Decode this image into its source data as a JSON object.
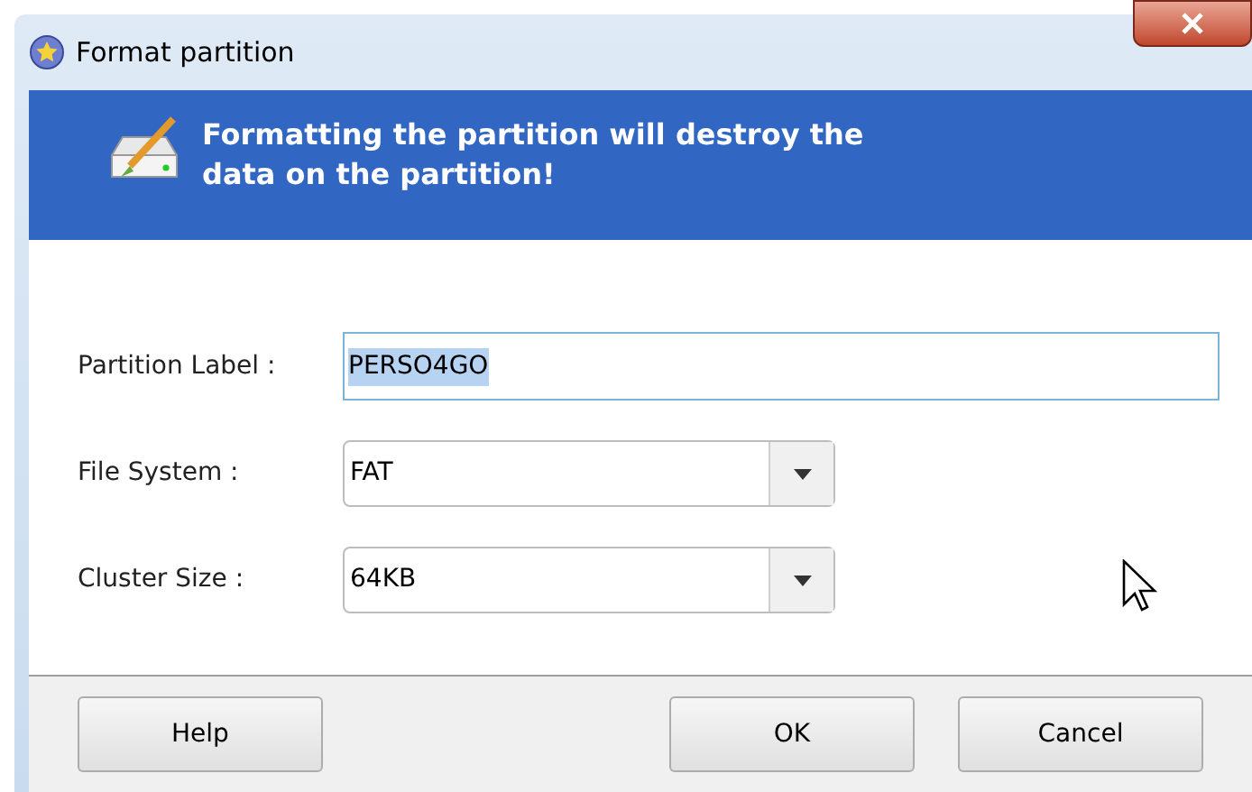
{
  "window": {
    "title": "Format partition"
  },
  "banner": {
    "message": "Formatting the partition will destroy the data on the partition!"
  },
  "fields": [
    {
      "kind": "text",
      "label": "Partition Label :",
      "value": "PERSO4GO",
      "value_selected": true
    },
    {
      "kind": "dropdown",
      "label": "File System :",
      "value": "FAT"
    },
    {
      "kind": "dropdown",
      "label": "Cluster Size :",
      "value": "64KB"
    }
  ],
  "buttons": [
    {
      "label": "Help",
      "kind": "left"
    },
    {
      "label": "OK",
      "kind": "right"
    },
    {
      "label": "Cancel",
      "kind": "right"
    }
  ]
}
